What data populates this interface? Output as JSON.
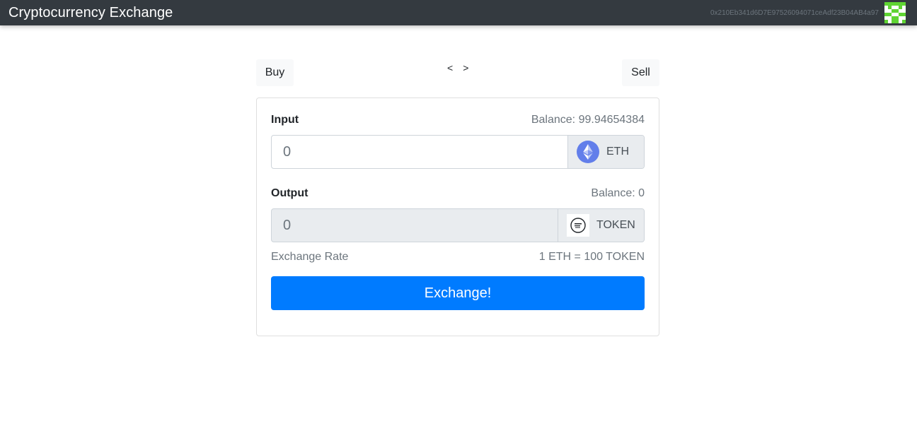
{
  "navbar": {
    "brand": "Cryptocurrency Exchange",
    "account": "0x210Eb341d6D7E97526094071ceAdf23B04AB4a97",
    "avatar_icon": "identicon-icon",
    "background": "#343a40"
  },
  "tabs": {
    "buy_label": "Buy",
    "sell_label": "Sell",
    "prev_label": "<",
    "next_label": ">"
  },
  "input": {
    "label": "Input",
    "balance": "Balance: 99.94654384",
    "placeholder": "0",
    "currency": "ETH",
    "currency_icon": "ethereum-icon"
  },
  "output": {
    "label": "Output",
    "balance": "Balance: 0",
    "value": "0",
    "currency": "TOKEN",
    "currency_icon": "token-logo-icon"
  },
  "rate": {
    "label": "Exchange Rate",
    "value": "1 ETH = 100 TOKEN"
  },
  "exchange_button": "Exchange!",
  "colors": {
    "primary": "#007bff",
    "eth": "#627eea",
    "identicon": "#5fd433"
  }
}
